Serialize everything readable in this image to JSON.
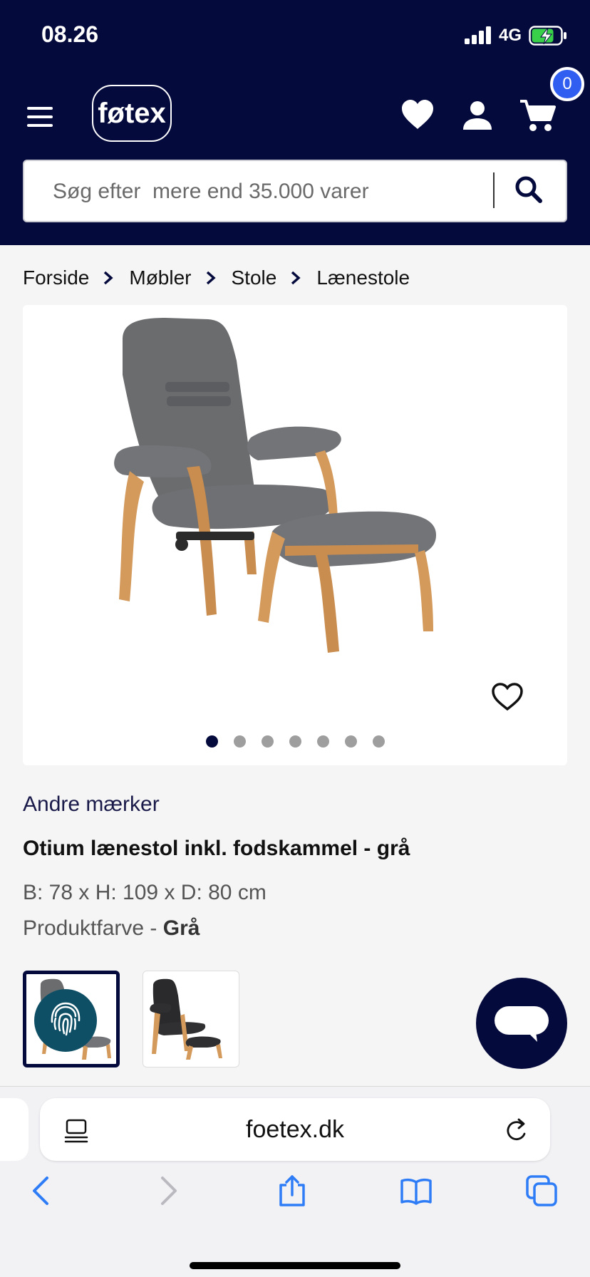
{
  "status": {
    "time": "08.26",
    "network": "4G"
  },
  "header": {
    "logo": "føtex",
    "cart_count": "0"
  },
  "search": {
    "placeholder": "Søg efter  mere end 35.000 varer"
  },
  "breadcrumb": [
    "Forside",
    "Møbler",
    "Stole",
    "Lænestole"
  ],
  "gallery": {
    "image_count": 7,
    "active_index": 0
  },
  "product": {
    "brand": "Andre mærker",
    "title": "Otium lænestol inkl. fodskammel - grå",
    "dimensions": "B: 78 x H: 109 x D: 80 cm",
    "color_label": "Produktfarve - ",
    "color_value": "Grå"
  },
  "browser": {
    "url": "foetex.dk"
  },
  "colors": {
    "navy": "#050a3c",
    "badge": "#2f5ef0",
    "fingerprint": "#0e4f66",
    "ios_blue": "#2e7cf6"
  }
}
